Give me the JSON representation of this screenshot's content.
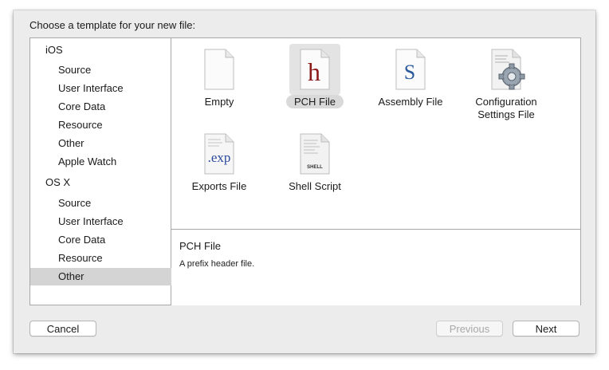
{
  "dialog": {
    "heading": "Choose a template for your new file:"
  },
  "sidebar": {
    "items": [
      {
        "label": "iOS",
        "kind": "group"
      },
      {
        "label": "Source",
        "kind": "sub"
      },
      {
        "label": "User Interface",
        "kind": "sub"
      },
      {
        "label": "Core Data",
        "kind": "sub"
      },
      {
        "label": "Resource",
        "kind": "sub"
      },
      {
        "label": "Other",
        "kind": "sub"
      },
      {
        "label": "Apple Watch",
        "kind": "sub"
      },
      {
        "label": "OS X",
        "kind": "group"
      },
      {
        "label": "Source",
        "kind": "sub"
      },
      {
        "label": "User Interface",
        "kind": "sub"
      },
      {
        "label": "Core Data",
        "kind": "sub"
      },
      {
        "label": "Resource",
        "kind": "sub"
      },
      {
        "label": "Other",
        "kind": "sub",
        "selected": true
      }
    ]
  },
  "templates": [
    {
      "label": "Empty",
      "icon": "blank-document-icon"
    },
    {
      "label": "PCH File",
      "icon": "header-document-icon",
      "glyph": "h",
      "selected": true
    },
    {
      "label": "Assembly File",
      "icon": "assembly-document-icon",
      "glyph": "S"
    },
    {
      "label": "Configuration Settings File",
      "icon": "configuration-gear-icon"
    },
    {
      "label": "Exports File",
      "icon": "exports-document-icon",
      "glyph": ".exp"
    },
    {
      "label": "Shell Script",
      "icon": "shell-script-icon",
      "glyph": "SHELL"
    }
  ],
  "description": {
    "title": "PCH File",
    "text": "A prefix header file."
  },
  "buttons": {
    "cancel": "Cancel",
    "previous": "Previous",
    "next": "Next"
  },
  "colors": {
    "header_glyph": "#8b1a1a",
    "assembly_glyph": "#2a5a9c",
    "exports_glyph": "#2a4a9c",
    "selection": "#d4d4d4"
  }
}
